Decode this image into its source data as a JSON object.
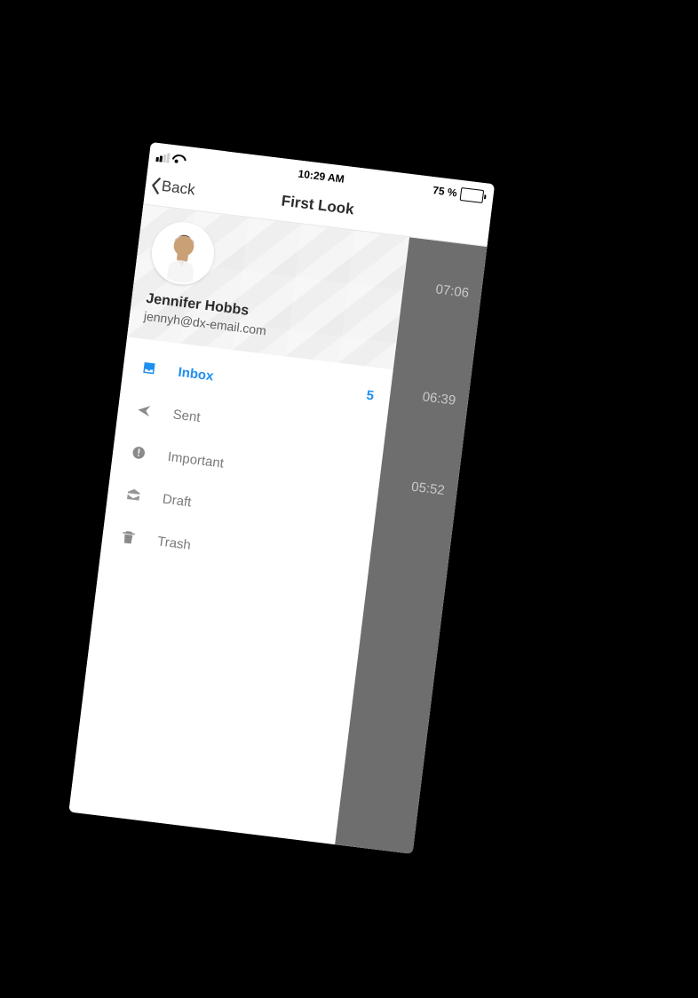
{
  "status": {
    "time": "10:29 AM",
    "battery_pct": "75 %",
    "battery_fill_pct": 75
  },
  "nav": {
    "back_label": "Back",
    "title": "First Look"
  },
  "profile": {
    "name": "Jennifer Hobbs",
    "email": "jennyh@dx-email.com"
  },
  "menu": {
    "items": [
      {
        "icon": "inbox",
        "label": "Inbox",
        "badge": "5",
        "active": true
      },
      {
        "icon": "sent",
        "label": "Sent",
        "badge": "",
        "active": false
      },
      {
        "icon": "important",
        "label": "Important",
        "badge": "",
        "active": false
      },
      {
        "icon": "draft",
        "label": "Draft",
        "badge": "",
        "active": false
      },
      {
        "icon": "trash",
        "label": "Trash",
        "badge": "",
        "active": false
      }
    ]
  },
  "peek_times": [
    "07:06",
    "06:39",
    "05:52"
  ]
}
